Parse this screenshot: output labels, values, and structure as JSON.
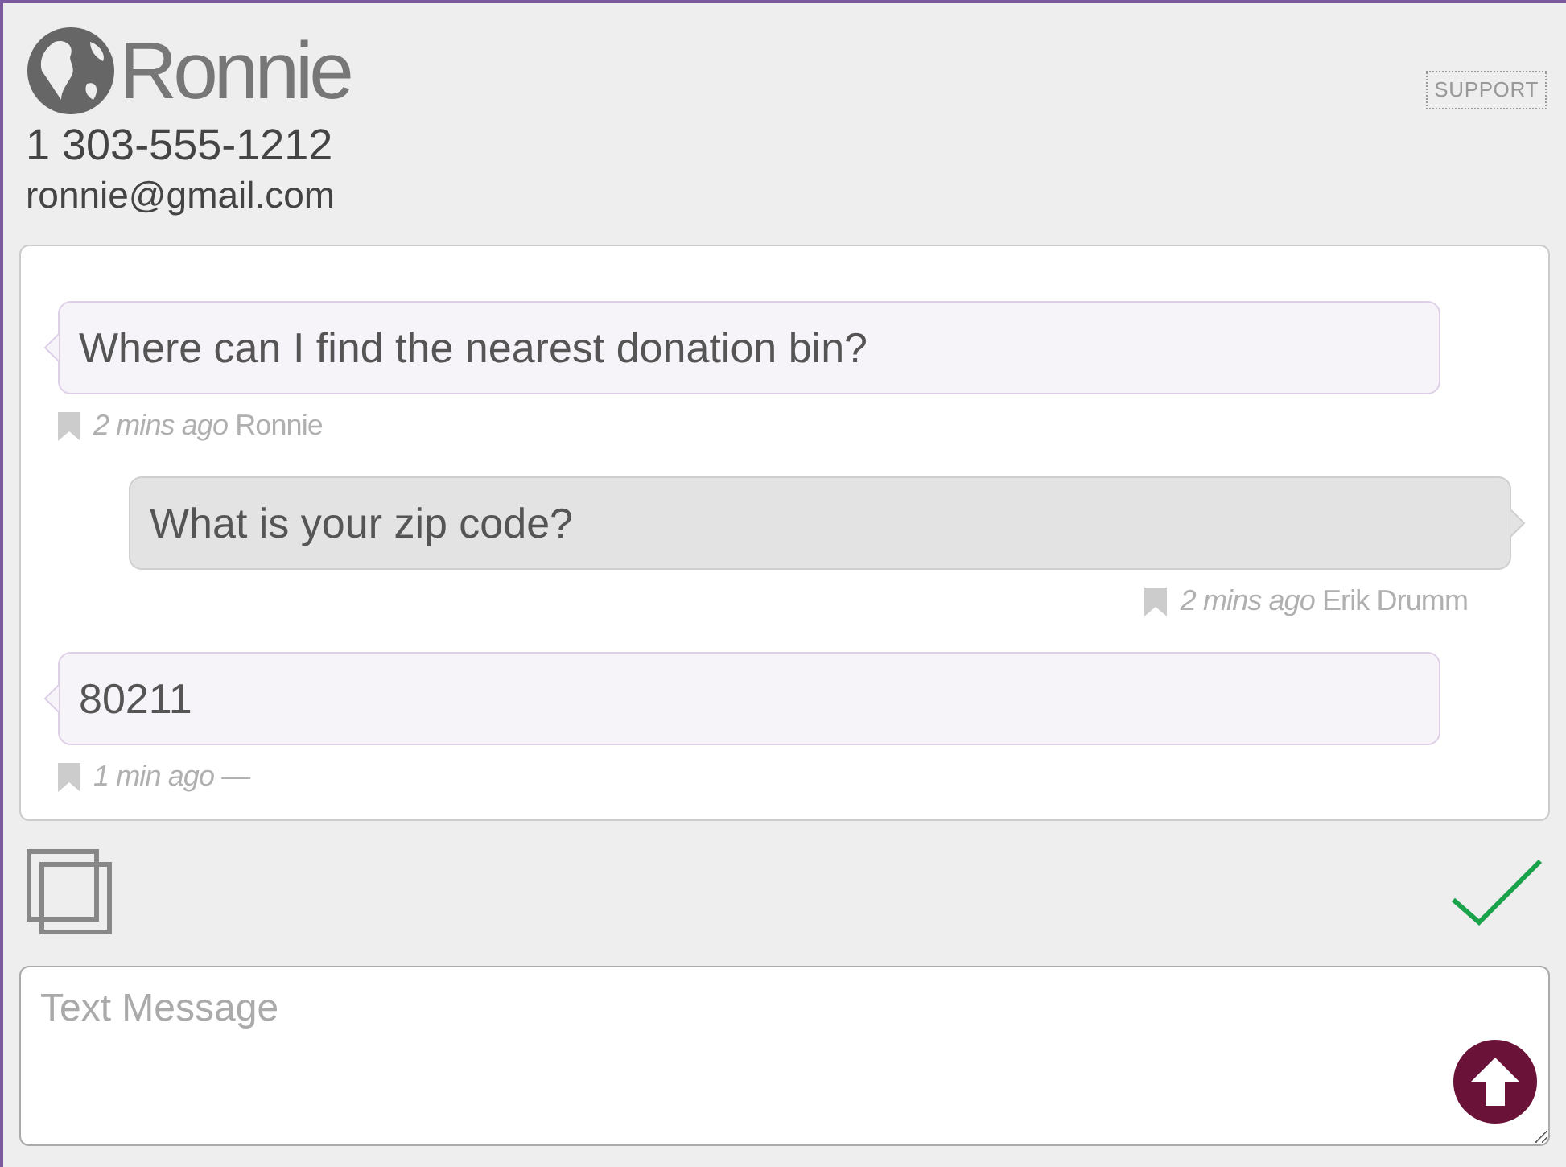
{
  "contact": {
    "name": "Ronnie",
    "phone": "1 303-555-1212",
    "email": "ronnie@gmail.com"
  },
  "support_label": "SUPPORT",
  "messages": [
    {
      "kind": "incoming",
      "text": "Where can I find the nearest donation bin?",
      "time": "2 mins ago",
      "author": "Ronnie"
    },
    {
      "kind": "outgoing",
      "text": "What is your zip code?",
      "time": "2 mins ago",
      "author": "Erik Drumm"
    },
    {
      "kind": "incoming",
      "text": "80211",
      "time": "1 min ago",
      "author": "—"
    }
  ],
  "composer": {
    "placeholder": "Text Message"
  }
}
